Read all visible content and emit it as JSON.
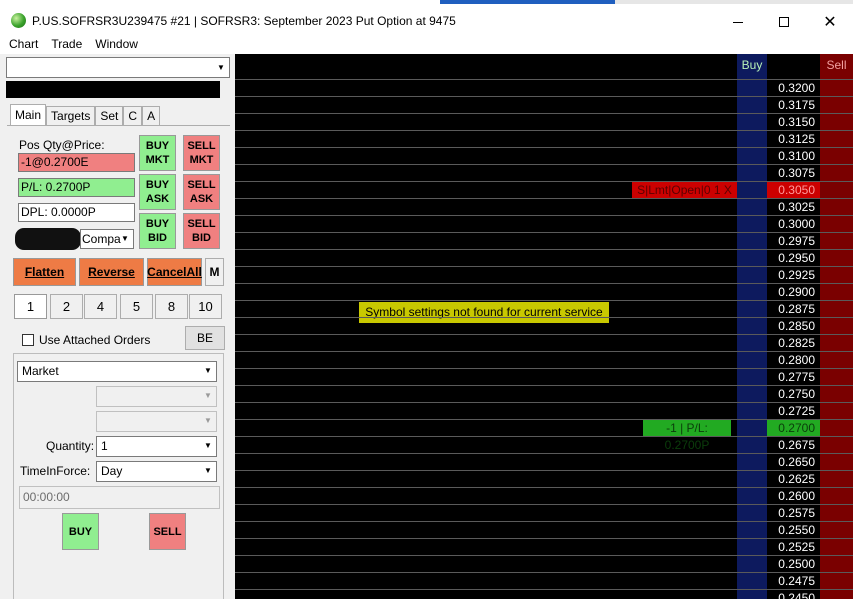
{
  "window": {
    "title": "P.US.SOFRSR3U239475  #21 | SOFRSR3: September 2023 Put Option at 9475",
    "minimize_icon": "minimize-icon",
    "maximize_icon": "maximize-icon",
    "close_icon": "close-icon",
    "close_glyph": "✕"
  },
  "menu": [
    "Chart",
    "Trade",
    "Window"
  ],
  "left_panel": {
    "account_select_value": "",
    "tabs": [
      "Main",
      "Targets",
      "Set",
      "C",
      "A"
    ],
    "active_tab": "Main",
    "pos_qty_label": "Pos Qty@Price:",
    "pos_qty_value": "-1@0.2700E",
    "pl_value": "P/L: 0.2700P",
    "dpl_value": "DPL: 0.0000P",
    "account_combo_value": "Compa",
    "buy_mkt": "BUY MKT",
    "sell_mkt": "SELL MKT",
    "buy_ask": "BUY ASK",
    "sell_ask": "SELL ASK",
    "buy_bid": "BUY BID",
    "sell_bid": "SELL BID",
    "flatten": "Flatten",
    "reverse": "Reverse",
    "cancel_all": "CancelAll",
    "m_button": "M",
    "quantities": [
      "1",
      "2",
      "4",
      "5",
      "8",
      "10"
    ],
    "active_quantity": "1",
    "use_attached_orders": "Use Attached Orders",
    "be_button": "BE",
    "order_type": "Market",
    "quantity_label": "Quantity:",
    "quantity_value": "1",
    "tif_label": "TimeInForce:",
    "tif_value": "Day",
    "time_value": "00:00:00",
    "buy_button": "BUY",
    "sell_button": "SELL"
  },
  "ladder": {
    "buy_header": "Buy",
    "sell_header": "Sell",
    "prices": [
      "0.3200",
      "0.3175",
      "0.3150",
      "0.3125",
      "0.3100",
      "0.3075",
      "0.3050",
      "0.3025",
      "0.3000",
      "0.2975",
      "0.2950",
      "0.2925",
      "0.2900",
      "0.2875",
      "0.2850",
      "0.2825",
      "0.2800",
      "0.2775",
      "0.2750",
      "0.2725",
      "0.2700",
      "0.2675",
      "0.2650",
      "0.2625",
      "0.2600",
      "0.2575",
      "0.2550",
      "0.2525",
      "0.2500",
      "0.2475",
      "0.2450"
    ],
    "working_order_price": "0.3050",
    "working_order_tag": "S|Lmt|Open|0  1  X",
    "position_price": "0.2700",
    "position_tag": "-1 | P/L: 0.2700P",
    "notice": "Symbol settings not found for current service"
  },
  "colors": {
    "buy_green": "#90ee90",
    "sell_red": "#f08080",
    "action_orange": "#ee7b45",
    "ladder_buy_col": "#0d1a5e",
    "ladder_sell_col": "#7a0000",
    "notice_yellow": "#c8c800"
  }
}
